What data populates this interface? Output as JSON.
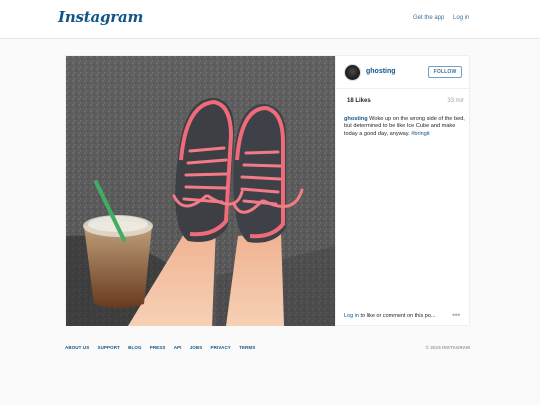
{
  "header": {
    "logo": "Instagram",
    "get_app": "Get the app",
    "login": "Log in"
  },
  "post": {
    "username": "ghosting",
    "follow": "FOLLOW",
    "likes": "18 Likes",
    "time_ago": "33 mir",
    "caption_user": "ghosting",
    "caption_text": " Woke up on the wrong side of the bed, but determined to be like Ice Cube and make today a good day, anyway. ",
    "caption_tag": "#bringit",
    "login_link": "Log in",
    "login_rest": " to like or comment on this po...",
    "more": "•••"
  },
  "footer": {
    "links": [
      "ABOUT US",
      "SUPPORT",
      "BLOG",
      "PRESS",
      "API",
      "JOBS",
      "PRIVACY",
      "TERMS"
    ],
    "copyright": "© 2015 INSTAGRAM"
  },
  "colors": {
    "brand": "#125688",
    "link": "#3f729b",
    "muted": "#a5a7aa"
  },
  "icons": [
    "user-avatar",
    "more-options-icon"
  ]
}
